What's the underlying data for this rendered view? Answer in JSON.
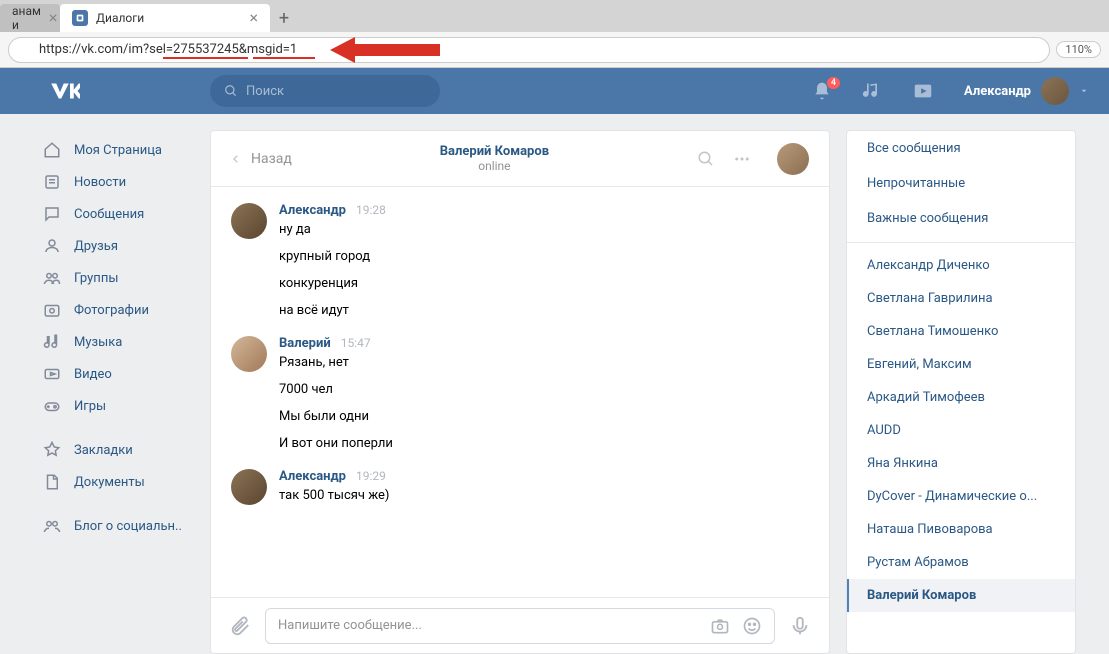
{
  "browser": {
    "tabs": [
      {
        "label": "анам и",
        "active": false
      },
      {
        "label": "Диалоги",
        "active": true
      }
    ],
    "url": "https://vk.com/im?sel=275537245&msgid=1",
    "zoom": "110%"
  },
  "header": {
    "search_placeholder": "Поиск",
    "notification_count": "4",
    "username": "Александр"
  },
  "nav": [
    {
      "icon": "home",
      "label": "Моя Страница"
    },
    {
      "icon": "news",
      "label": "Новости"
    },
    {
      "icon": "messages",
      "label": "Сообщения"
    },
    {
      "icon": "friends",
      "label": "Друзья"
    },
    {
      "icon": "groups",
      "label": "Группы"
    },
    {
      "icon": "photos",
      "label": "Фотографии"
    },
    {
      "icon": "music",
      "label": "Музыка"
    },
    {
      "icon": "video",
      "label": "Видео"
    },
    {
      "icon": "games",
      "label": "Игры"
    },
    {
      "sep": true
    },
    {
      "icon": "bookmarks",
      "label": "Закладки"
    },
    {
      "icon": "docs",
      "label": "Документы"
    },
    {
      "sep": true
    },
    {
      "icon": "blog",
      "label": "Блог о социальн.."
    }
  ],
  "chat": {
    "back_label": "Назад",
    "title": "Валерий Комаров",
    "status": "online",
    "messages": [
      {
        "author": "Александр",
        "time": "19:28",
        "avatar": "a1",
        "lines": [
          "ну да",
          "крупный город",
          "конкуренция",
          "на всё идут"
        ]
      },
      {
        "author": "Валерий",
        "time": "15:47",
        "avatar": "a2",
        "lines": [
          "Рязань, нет",
          "7000 чел",
          "Мы были одни",
          "И вот они поперли"
        ]
      },
      {
        "author": "Александр",
        "time": "19:29",
        "avatar": "a1",
        "lines": [
          "так 500 тысяч же)"
        ]
      }
    ],
    "composer_placeholder": "Напишите сообщение..."
  },
  "right": {
    "filters": [
      "Все сообщения",
      "Непрочитанные",
      "Важные сообщения"
    ],
    "dialogs": [
      "Александр Диченко",
      "Светлана Гаврилина",
      "Светлана Тимошенко",
      "Евгений, Максим",
      "Аркадий Тимофеев",
      "AUDD",
      "Яна Янкина",
      "DyCover - Динамические о...",
      "Наташа Пивоварова",
      "Рустам Абрамов",
      "Валерий Комаров"
    ],
    "active_dialog": "Валерий Комаров"
  }
}
